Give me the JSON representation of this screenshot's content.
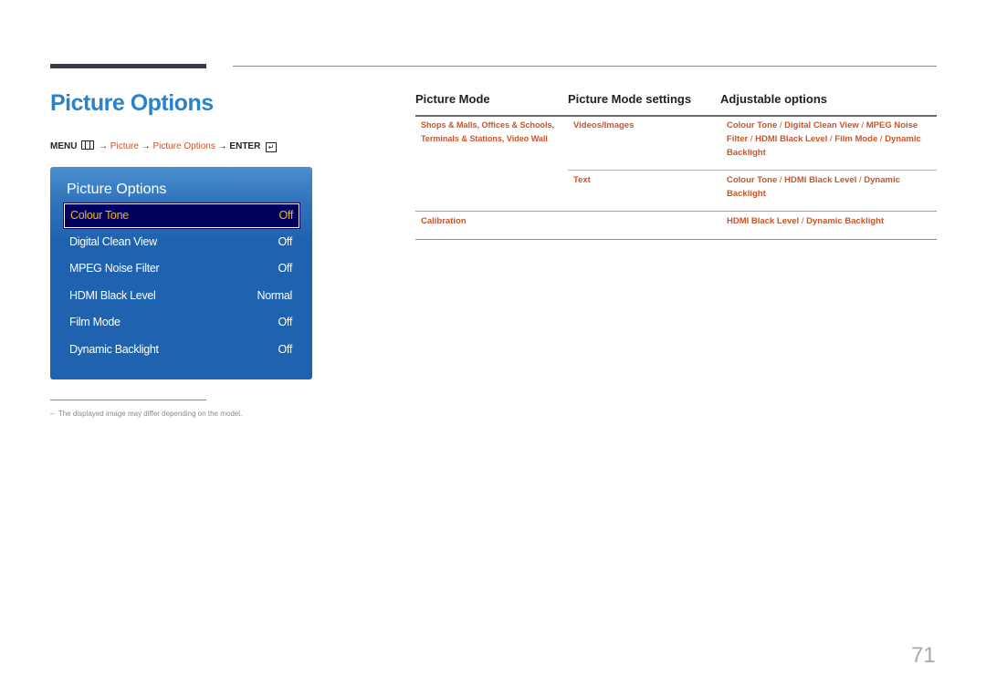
{
  "page": {
    "title": "Picture Options",
    "page_number": "71"
  },
  "menu_path": {
    "menu": "MENU",
    "arrow": "→",
    "step1": "Picture",
    "step2": "Picture Options",
    "enter": "ENTER",
    "menu_icon": "menu-grid-icon",
    "enter_icon": "enter-return-icon"
  },
  "osd": {
    "title": "Picture Options",
    "items": [
      {
        "label": "Colour Tone",
        "value": "Off",
        "selected": true
      },
      {
        "label": "Digital Clean View",
        "value": "Off"
      },
      {
        "label": "MPEG Noise Filter",
        "value": "Off"
      },
      {
        "label": "HDMI Black Level",
        "value": "Normal"
      },
      {
        "label": "Film Mode",
        "value": "Off"
      },
      {
        "label": "Dynamic Backlight",
        "value": "Off"
      }
    ],
    "colors": {
      "selected_text": "#f2b418",
      "selected_bg": "#02025e",
      "panel": "#1f63b0"
    }
  },
  "footnote": "The displayed image may differ depending on the model.",
  "table": {
    "headers": [
      "Picture Mode",
      "Picture Mode settings",
      "Adjustable options"
    ],
    "rows": [
      {
        "mode_line1": "Shops & Malls, Offices & Schools,",
        "mode_line2": "Terminals & Stations, Video Wall",
        "setting": "Videos/Images",
        "options": [
          "Colour Tone",
          "Digital Clean View",
          "MPEG Noise Filter",
          "HDMI Black Level",
          "Film Mode",
          "Dynamic Backlight"
        ]
      },
      {
        "mode_line1": "",
        "setting": "Text",
        "options": [
          "Colour Tone",
          "HDMI Black Level",
          "Dynamic Backlight"
        ]
      },
      {
        "mode_line1": "Calibration",
        "setting": "",
        "options": [
          "HDMI Black Level",
          "Dynamic Backlight"
        ]
      }
    ],
    "link_color": "#c9542b"
  }
}
